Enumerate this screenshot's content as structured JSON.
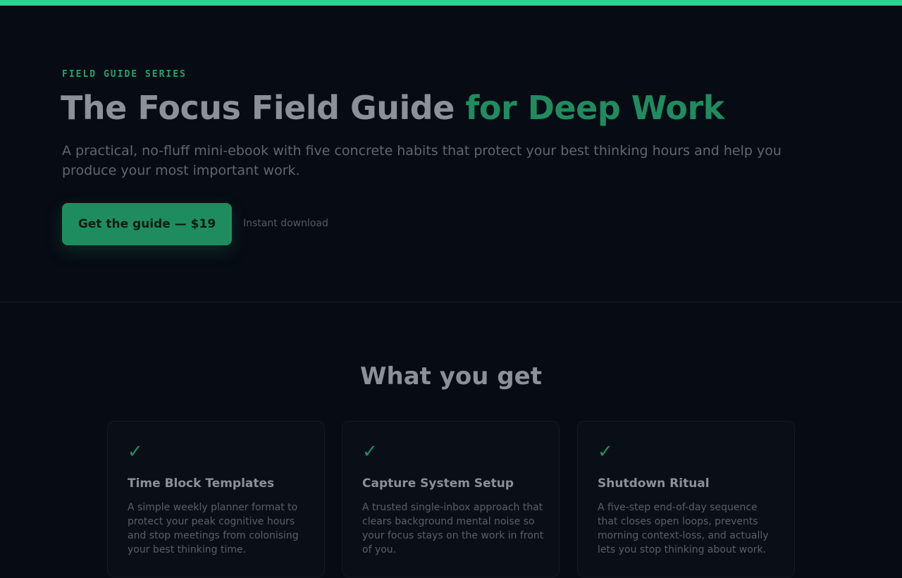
{
  "colors": {
    "accent": "#2dd38e",
    "accent_dim": "#1f8c60",
    "background": "#070b13",
    "card_background": "#0a0f17"
  },
  "hero": {
    "eyebrow": "FIELD GUIDE SERIES",
    "title_main": "The Focus Field Guide ",
    "title_accent": "for Deep Work",
    "subtitle": "A practical, no-fluff mini-ebook with five concrete habits that protect your best thinking hours and help you produce your most important work.",
    "cta_label": "Get the guide — $19",
    "cta_note": "Instant download"
  },
  "features": {
    "title": "What you get",
    "cards": [
      {
        "icon": "check-icon",
        "check": "✓",
        "title": "Time Block Templates",
        "description": "A simple weekly planner format to protect your peak cognitive hours and stop meetings from colonising your best thinking time."
      },
      {
        "icon": "check-icon",
        "check": "✓",
        "title": "Capture System Setup",
        "description": "A trusted single-inbox approach that clears background mental noise so your focus stays on the work in front of you."
      },
      {
        "icon": "check-icon",
        "check": "✓",
        "title": "Shutdown Ritual",
        "description": "A five-step end-of-day sequence that closes open loops, prevents morning context-loss, and actually lets you stop thinking about work."
      }
    ]
  }
}
